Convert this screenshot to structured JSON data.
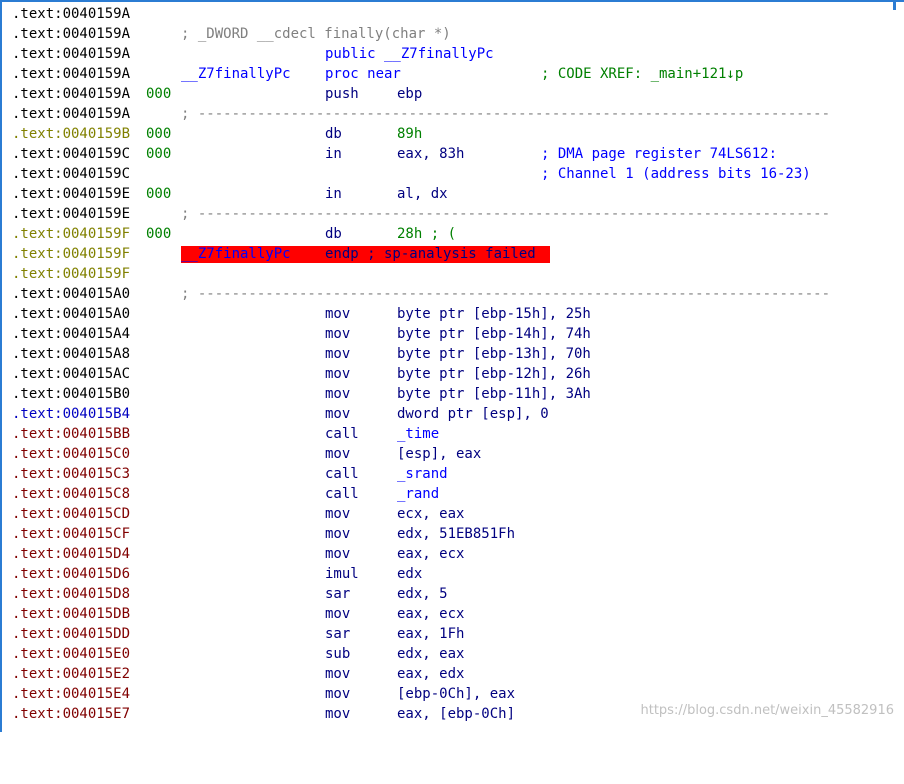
{
  "colors": {
    "frame": "#2b7cd3",
    "text": "#000000",
    "mnemonic": "#000080",
    "operand": "#000080",
    "number": "#008000",
    "comment": "#0000ff",
    "separator": "#808080",
    "highlight": "#ff0000",
    "addr_olive": "#808000",
    "addr_blue": "#0000c0",
    "addr_red": "#800000"
  },
  "lines": [
    {
      "addr": ".text:0040159A"
    },
    {
      "addr": ".text:0040159A",
      "name": "; _DWORD __cdecl finally(char *)"
    },
    {
      "addr": ".text:0040159A",
      "mnem": "public __Z7finallyPc"
    },
    {
      "addr": ".text:0040159A",
      "name": "__Z7finallyPc",
      "mnem": "proc near",
      "cmt": "; CODE XREF: _main+121↓p"
    },
    {
      "addr": ".text:0040159A",
      "prefix": "000",
      "mnem": "push",
      "opnd": "ebp"
    },
    {
      "addr": ".text:0040159A",
      "sep": "; ---------------------------------------------------------------------------"
    },
    {
      "addr": ".text:0040159B",
      "prefix": "000",
      "mnem": "db",
      "opnd": "89h"
    },
    {
      "addr": ".text:0040159C",
      "prefix": "000",
      "mnem": "in",
      "opnd": "eax, 83h",
      "cmt": "; DMA page register 74LS612:"
    },
    {
      "addr": ".text:0040159C",
      "cmt": "; Channel 1 (address bits 16-23)"
    },
    {
      "addr": ".text:0040159E",
      "prefix": "000",
      "mnem": "in",
      "opnd": "al, dx"
    },
    {
      "addr": ".text:0040159E",
      "sep": "; ---------------------------------------------------------------------------"
    },
    {
      "addr": ".text:0040159F",
      "prefix": "000",
      "mnem": "db",
      "opnd": "28h ; ("
    },
    {
      "addr": ".text:0040159F",
      "name": "__Z7finallyPc",
      "mnem": "endp ; sp-analysis failed"
    },
    {
      "addr": ".text:0040159F"
    },
    {
      "addr": ".text:004015A0",
      "sep": "; ---------------------------------------------------------------------------"
    },
    {
      "addr": ".text:004015A0",
      "mnem": "mov",
      "opnd": "byte ptr [ebp-15h], 25h"
    },
    {
      "addr": ".text:004015A4",
      "mnem": "mov",
      "opnd": "byte ptr [ebp-14h], 74h"
    },
    {
      "addr": ".text:004015A8",
      "mnem": "mov",
      "opnd": "byte ptr [ebp-13h], 70h"
    },
    {
      "addr": ".text:004015AC",
      "mnem": "mov",
      "opnd": "byte ptr [ebp-12h], 26h"
    },
    {
      "addr": ".text:004015B0",
      "mnem": "mov",
      "opnd": "byte ptr [ebp-11h], 3Ah"
    },
    {
      "addr": ".text:004015B4",
      "mnem": "mov",
      "opnd": "dword ptr [esp], 0"
    },
    {
      "addr": ".text:004015BB",
      "mnem": "call",
      "opnd": "_time"
    },
    {
      "addr": ".text:004015C0",
      "mnem": "mov",
      "opnd": "[esp], eax"
    },
    {
      "addr": ".text:004015C3",
      "mnem": "call",
      "opnd": "_srand"
    },
    {
      "addr": ".text:004015C8",
      "mnem": "call",
      "opnd": "_rand"
    },
    {
      "addr": ".text:004015CD",
      "mnem": "mov",
      "opnd": "ecx, eax"
    },
    {
      "addr": ".text:004015CF",
      "mnem": "mov",
      "opnd": "edx, 51EB851Fh"
    },
    {
      "addr": ".text:004015D4",
      "mnem": "mov",
      "opnd": "eax, ecx"
    },
    {
      "addr": ".text:004015D6",
      "mnem": "imul",
      "opnd": "edx"
    },
    {
      "addr": ".text:004015D8",
      "mnem": "sar",
      "opnd": "edx, 5"
    },
    {
      "addr": ".text:004015DB",
      "mnem": "mov",
      "opnd": "eax, ecx"
    },
    {
      "addr": ".text:004015DD",
      "mnem": "sar",
      "opnd": "eax, 1Fh"
    },
    {
      "addr": ".text:004015E0",
      "mnem": "sub",
      "opnd": "edx, eax"
    },
    {
      "addr": ".text:004015E2",
      "mnem": "mov",
      "opnd": "eax, edx"
    },
    {
      "addr": ".text:004015E4",
      "mnem": "mov",
      "opnd": "[ebp-0Ch], eax"
    },
    {
      "addr": ".text:004015E7",
      "mnem": "mov",
      "opnd": "eax, [ebp-0Ch]"
    }
  ],
  "watermark": "https://blog.csdn.net/weixin_45582916"
}
